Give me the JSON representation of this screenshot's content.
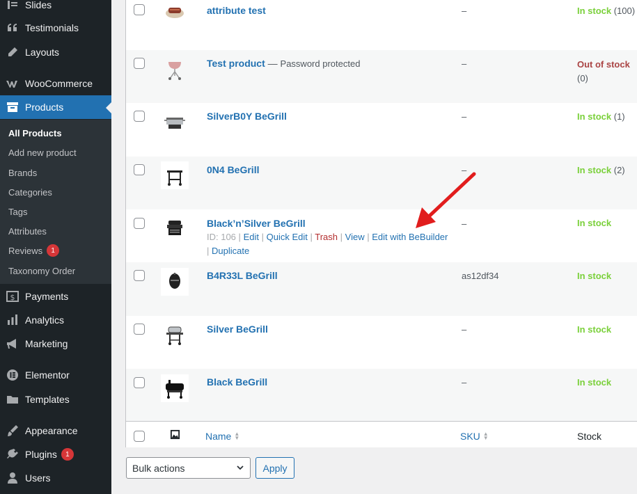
{
  "sidebar": {
    "items": [
      {
        "label": "Slides",
        "icon": "slides-icon"
      },
      {
        "label": "Testimonials",
        "icon": "quote-icon"
      },
      {
        "label": "Layouts",
        "icon": "pencil-icon"
      },
      {
        "label": "WooCommerce",
        "icon": "woocommerce-icon"
      },
      {
        "label": "Products",
        "icon": "archive-icon"
      },
      {
        "label": "Payments",
        "icon": "dollar-icon"
      },
      {
        "label": "Analytics",
        "icon": "bar-chart-icon"
      },
      {
        "label": "Marketing",
        "icon": "megaphone-icon"
      },
      {
        "label": "Elementor",
        "icon": "elementor-icon"
      },
      {
        "label": "Templates",
        "icon": "folder-icon"
      },
      {
        "label": "Appearance",
        "icon": "brush-icon"
      },
      {
        "label": "Plugins",
        "icon": "plug-icon",
        "badge": "1"
      },
      {
        "label": "Users",
        "icon": "user-icon"
      }
    ],
    "submenu": [
      {
        "label": "All Products"
      },
      {
        "label": "Add new product"
      },
      {
        "label": "Brands"
      },
      {
        "label": "Categories"
      },
      {
        "label": "Tags"
      },
      {
        "label": "Attributes"
      },
      {
        "label": "Reviews",
        "badge": "1"
      },
      {
        "label": "Taxonomy Order"
      }
    ]
  },
  "products": [
    {
      "name": "attribute test",
      "sku": "–",
      "stock_status": "In stock",
      "stock_qty": "(100)",
      "thumb": "food-icon"
    },
    {
      "name": "Test product",
      "suffix": "Password protected",
      "sku": "–",
      "stock_status": "Out of stock",
      "stock_qty": "(0)",
      "thumb": "kettle-grill-icon"
    },
    {
      "name": "SilverB0Y BeGrill",
      "sku": "–",
      "stock_status": "In stock",
      "stock_qty": "(1)",
      "thumb": "gas-grill-icon"
    },
    {
      "name": "0N4 BeGrill",
      "sku": "–",
      "stock_status": "In stock",
      "stock_qty": "(2)",
      "thumb": "cart-grill-icon"
    },
    {
      "name": "Black’n’Silver BeGrill",
      "sku": "–",
      "stock_status": "In stock",
      "stock_qty": "",
      "thumb": "black-grill-icon",
      "actions": {
        "id": "ID: 106",
        "edit": "Edit",
        "quick_edit": "Quick Edit",
        "trash": "Trash",
        "view": "View",
        "edit_builder": "Edit with BeBuilder",
        "duplicate": "Duplicate",
        "sep": "|"
      }
    },
    {
      "name": "B4R33L BeGrill",
      "sku": "as12df34",
      "stock_status": "In stock",
      "stock_qty": "",
      "thumb": "egg-grill-icon"
    },
    {
      "name": "Silver BeGrill",
      "sku": "–",
      "stock_status": "In stock",
      "stock_qty": "",
      "thumb": "wheeled-grill-icon"
    },
    {
      "name": "Black BeGrill",
      "sku": "–",
      "stock_status": "In stock",
      "stock_qty": "",
      "thumb": "smoker-grill-icon"
    }
  ],
  "table_footer": {
    "name": "Name",
    "sku": "SKU",
    "stock": "Stock",
    "image_col_icon": "image-icon"
  },
  "bulk_actions": {
    "selected": "Bulk actions",
    "apply": "Apply"
  },
  "colors": {
    "accent": "#2271b1",
    "in_stock": "#7ad03a",
    "out_of_stock": "#a44",
    "sidebar_bg": "#1d2327",
    "annotation_arrow": "#e11d1d"
  }
}
